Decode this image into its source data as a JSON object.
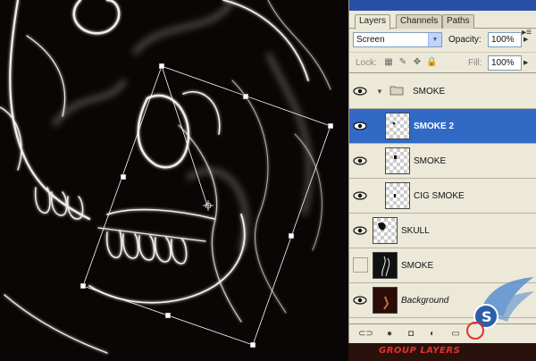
{
  "panel": {
    "tabs": [
      {
        "label": "Layers",
        "active": true
      },
      {
        "label": "Channels",
        "active": false
      },
      {
        "label": "Paths",
        "active": false
      }
    ],
    "menu_glyph": "▸≡",
    "blend_mode": "Screen",
    "opacity_label": "Opacity:",
    "opacity_value": "100%",
    "lock_label": "Lock:",
    "fill_label": "Fill:",
    "fill_value": "100%"
  },
  "layers": [
    {
      "name": "SMOKE",
      "type": "group",
      "visible": true,
      "selected": false
    },
    {
      "name": "SMOKE 2",
      "type": "layer",
      "visible": true,
      "selected": true,
      "indented": true
    },
    {
      "name": "SMOKE",
      "type": "layer",
      "visible": true,
      "selected": false,
      "indented": true
    },
    {
      "name": "CIG SMOKE",
      "type": "layer",
      "visible": true,
      "selected": false,
      "indented": true
    },
    {
      "name": "SKULL",
      "type": "layer",
      "visible": true,
      "selected": false
    },
    {
      "name": "SMOKE",
      "type": "layer",
      "visible": false,
      "selected": false
    },
    {
      "name": "Background",
      "type": "background",
      "visible": true,
      "selected": false
    }
  ],
  "footer": {
    "caption": "GROUP LAYERS"
  },
  "icons": {
    "eye": "eye-icon",
    "folder": "folder-icon",
    "link": "link-icon",
    "fx": "fx-icon",
    "mask": "mask-icon",
    "adjustment": "adjustment-icon",
    "new_group": "new-group-icon"
  },
  "colors": {
    "selection": "#316ac5",
    "panel_bg": "#ece9d8",
    "caption": "#e8302a"
  }
}
